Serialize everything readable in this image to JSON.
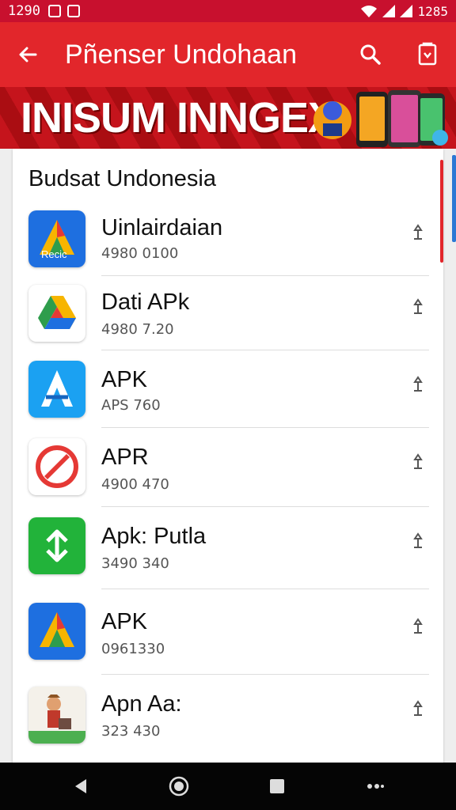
{
  "status_bar": {
    "time": "1290",
    "right_text": "1285"
  },
  "app_bar": {
    "title": "Pñenser Undohaan"
  },
  "banner": {
    "text": "INISUM INNGEX"
  },
  "section": {
    "title": "Budsat Undonesia"
  },
  "items": [
    {
      "name": "Uinlairdaian",
      "meta": "4980 0100",
      "icon": "apk-a-icon",
      "icon_label": "Recic"
    },
    {
      "name": "Dati APk",
      "meta": "4980 7.20",
      "icon": "drive-triangle-icon"
    },
    {
      "name": "APK",
      "meta": "APS 760",
      "icon": "store-a-icon"
    },
    {
      "name": "APR",
      "meta": "4900 470",
      "icon": "red-circle-icon"
    },
    {
      "name": "Apk: Putla",
      "meta": "3490 340",
      "icon": "green-refresh-icon"
    },
    {
      "name": "APK",
      "meta": "0961330",
      "icon": "apk-a-blue-icon"
    },
    {
      "name": "Apn Aa:",
      "meta": "323 430",
      "icon": "character-game-icon"
    }
  ],
  "colors": {
    "primary": "#e2262b",
    "status": "#c8102e",
    "banner": "#c5141c",
    "nav": "#050505"
  }
}
